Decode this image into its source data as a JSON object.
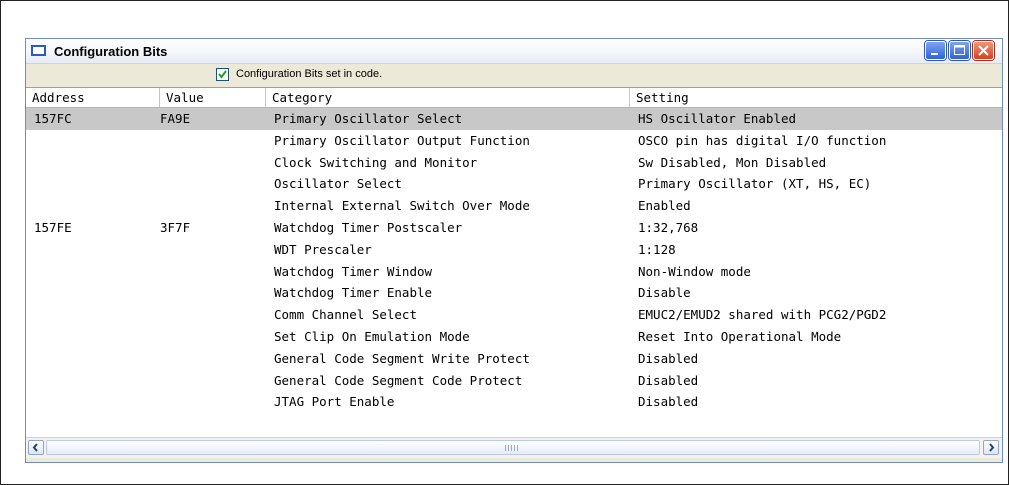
{
  "window": {
    "title": "Configuration Bits",
    "icon": "window-icon",
    "buttons": [
      "minimize-icon",
      "maximize-icon",
      "close-icon"
    ]
  },
  "checkbox": {
    "label": "Configuration Bits set in code.",
    "checked": true
  },
  "table": {
    "headers": [
      "Address",
      "Value",
      "Category",
      "Setting"
    ],
    "rows": [
      {
        "address": "157FC",
        "value": "FA9E",
        "category": "Primary Oscillator Select",
        "setting": "HS Oscillator Enabled"
      },
      {
        "address": "",
        "value": "",
        "category": "Primary Oscillator Output Function",
        "setting": "OSCO pin has digital I/O function"
      },
      {
        "address": "",
        "value": "",
        "category": "Clock Switching and Monitor",
        "setting": "Sw Disabled, Mon Disabled"
      },
      {
        "address": "",
        "value": "",
        "category": "Oscillator Select",
        "setting": "Primary Oscillator (XT, HS, EC)"
      },
      {
        "address": "",
        "value": "",
        "category": "Internal External Switch Over Mode",
        "setting": "Enabled"
      },
      {
        "address": "157FE",
        "value": "3F7F",
        "category": "Watchdog Timer Postscaler",
        "setting": "1:32,768"
      },
      {
        "address": "",
        "value": "",
        "category": "WDT Prescaler",
        "setting": "1:128"
      },
      {
        "address": "",
        "value": "",
        "category": "Watchdog Timer Window",
        "setting": "Non-Window mode"
      },
      {
        "address": "",
        "value": "",
        "category": "Watchdog Timer Enable",
        "setting": "Disable"
      },
      {
        "address": "",
        "value": "",
        "category": "Comm Channel Select",
        "setting": "EMUC2/EMUD2 shared with PCG2/PGD2"
      },
      {
        "address": "",
        "value": "",
        "category": "Set Clip On Emulation Mode",
        "setting": "Reset Into Operational Mode"
      },
      {
        "address": "",
        "value": "",
        "category": "General Code Segment Write Protect",
        "setting": "Disabled"
      },
      {
        "address": "",
        "value": "",
        "category": "General Code Segment Code Protect",
        "setting": "Disabled"
      },
      {
        "address": "",
        "value": "",
        "category": "JTAG Port Enable",
        "setting": "Disabled"
      }
    ],
    "selected_row": 0
  },
  "colors": {
    "selected_row": "#c8c8c8",
    "window_border": "#6f8cc9",
    "close_button": "#d6401e"
  }
}
